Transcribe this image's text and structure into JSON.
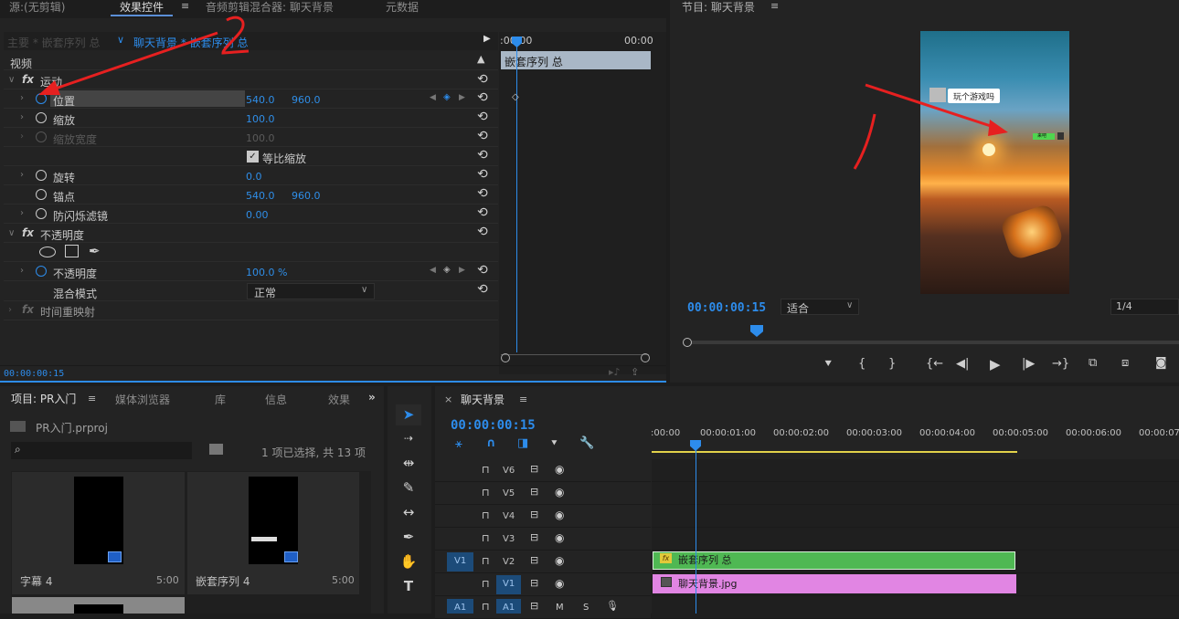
{
  "source_panel": {
    "tabs": [
      "源:(无剪辑)",
      "效果控件",
      "音频剪辑混合器: 聊天背景",
      "元数据"
    ]
  },
  "effect_controls": {
    "master": "主要 * 嵌套序列 总",
    "clip": "聊天背景 * 嵌套序列 总",
    "timecodes": [
      ":00:00",
      "00:00"
    ],
    "ruler_clip": "嵌套序列 总",
    "video_label": "视频",
    "sections": {
      "motion": "运动",
      "opacity": "不透明度",
      "time_remap": "时间重映射"
    },
    "props": {
      "position": {
        "label": "位置",
        "x": "540.0",
        "y": "960.0"
      },
      "scale": {
        "label": "缩放",
        "v": "100.0"
      },
      "scale_width": {
        "label": "缩放宽度",
        "v": "100.0"
      },
      "uniform": "等比缩放",
      "rotation": {
        "label": "旋转",
        "v": "0.0"
      },
      "anchor": {
        "label": "锚点",
        "x": "540.0",
        "y": "960.0"
      },
      "flicker": {
        "label": "防闪烁滤镜",
        "v": "0.00"
      },
      "opacity": {
        "label": "不透明度",
        "v": "100.0 %"
      },
      "blend": {
        "label": "混合模式",
        "v": "正常"
      }
    },
    "current_time": "00:00:00:15"
  },
  "annotation": {
    "num": "2"
  },
  "program": {
    "title": "节目: 聊天背景",
    "timecode": "00:00:00:15",
    "fit": "适合",
    "ratio": "1/4",
    "bubble_text": "玩个游戏吗",
    "green_bubble": "来吧"
  },
  "project": {
    "tabs": [
      "项目: PR入门",
      "媒体浏览器",
      "库",
      "信息",
      "效果"
    ],
    "file": "PR入门.prproj",
    "status": "1 项已选择, 共 13 项",
    "items": [
      {
        "name": "字幕 4",
        "dur": "5:00"
      },
      {
        "name": "嵌套序列 4",
        "dur": "5:00"
      }
    ]
  },
  "timeline": {
    "title": "聊天背景",
    "timecode": "00:00:00:15",
    "ruler": [
      ":00:00",
      "00:00:01:00",
      "00:00:02:00",
      "00:00:03:00",
      "00:00:04:00",
      "00:00:05:00",
      "00:00:06:00",
      "00:00:07:"
    ],
    "tracks": [
      "V6",
      "V5",
      "V4",
      "V3",
      "V2",
      "V1",
      "A1"
    ],
    "src_v1": "V1",
    "src_a1": "A1",
    "clip_v2": "嵌套序列 总",
    "clip_v1": "聊天背景.jpg",
    "a1_m": "M",
    "a1_s": "S"
  }
}
